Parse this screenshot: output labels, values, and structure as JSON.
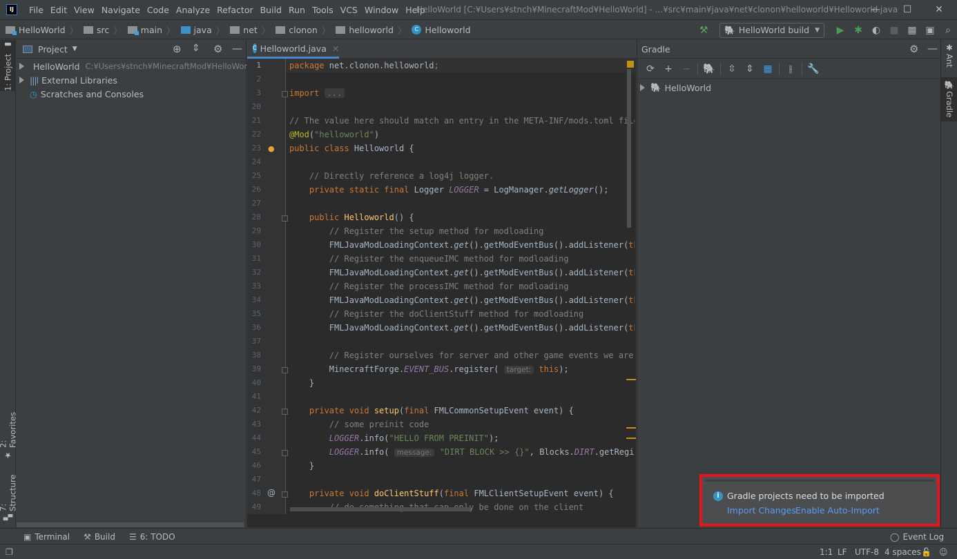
{
  "titlebar": {
    "app_icon": "intellij-idea-icon",
    "menu": [
      "File",
      "Edit",
      "View",
      "Navigate",
      "Code",
      "Analyze",
      "Refactor",
      "Build",
      "Run",
      "Tools",
      "VCS",
      "Window",
      "Help"
    ],
    "window_title": "HelloWorld [C:¥Users¥stnch¥MinecraftMod¥HelloWorld] - ...¥src¥main¥java¥net¥clonon¥helloworld¥Helloworld.java",
    "controls": {
      "minimize": "—",
      "maximize": "☐",
      "close": "✕"
    }
  },
  "breadcrumb": [
    "HelloWorld",
    "src",
    "main",
    "java",
    "net",
    "clonon",
    "helloworld",
    "Helloworld"
  ],
  "toolbar": {
    "run_config": "HelloWorld build",
    "icons": [
      "hammer-build-icon",
      "run-icon",
      "debug-icon",
      "coverage-icon",
      "stop-icon",
      "project-structure-icon",
      "terminal-window-icon",
      "search-icon"
    ]
  },
  "left_strip": {
    "tabs": [
      "1: Project",
      "2: Favorites",
      "7: Structure"
    ]
  },
  "right_strip": {
    "tabs": [
      "Ant",
      "Gradle"
    ]
  },
  "project_panel": {
    "title": "Project",
    "items": [
      {
        "label": "HelloWorld",
        "path": "C:¥Users¥stnch¥MinecraftMod¥HelloWorld",
        "expandable": true
      },
      {
        "label": "External Libraries",
        "expandable": true
      },
      {
        "label": "Scratches and Consoles",
        "expandable": false
      }
    ]
  },
  "editor": {
    "tab_label": "Helloworld.java",
    "hints": {
      "target": "target:",
      "message": "message:"
    },
    "line_numbers": [
      "1",
      "2",
      "3",
      "20",
      "21",
      "22",
      "23",
      "24",
      "25",
      "26",
      "27",
      "28",
      "29",
      "30",
      "31",
      "32",
      "33",
      "34",
      "35",
      "36",
      "37",
      "38",
      "39",
      "40",
      "41",
      "42",
      "43",
      "44",
      "45",
      "46",
      "47",
      "48",
      "49"
    ]
  },
  "gradle_panel": {
    "title": "Gradle",
    "tree": [
      {
        "label": "HelloWorld",
        "expandable": true
      }
    ]
  },
  "notification": {
    "message": "Gradle projects need to be imported",
    "actions": [
      "Import Changes",
      "Enable Auto-Import"
    ],
    "highlight_color": "#e8141c"
  },
  "bottom_tools": [
    {
      "label": "Terminal",
      "icon": "terminal-icon"
    },
    {
      "label": "Build",
      "icon": "hammer-icon"
    },
    {
      "label": "6: TODO",
      "icon": "list-icon"
    }
  ],
  "event_log": "Event Log",
  "statusbar": {
    "position": "1:1",
    "line_sep": "LF",
    "encoding": "UTF-8",
    "indent": "4 spaces"
  }
}
